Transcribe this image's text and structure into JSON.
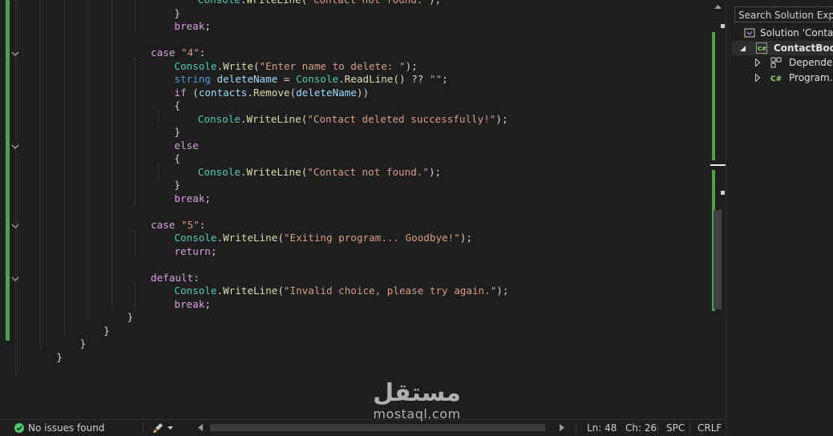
{
  "editor": {
    "lines": [
      [
        [
          "tk-class",
          "Console"
        ],
        [
          "tk-punct",
          "."
        ],
        [
          "tk-method",
          "WriteLine"
        ],
        [
          "tk-punct",
          "("
        ],
        [
          "tk-string",
          "\"Contact not found.\""
        ],
        [
          "tk-punct",
          ");"
        ]
      ],
      [
        [
          "tk-punct",
          "}"
        ]
      ],
      [
        [
          "tk-control",
          "break"
        ],
        [
          "tk-punct",
          ";"
        ]
      ],
      [],
      [
        [
          "tk-control",
          "case"
        ],
        [
          "tk-punct",
          " "
        ],
        [
          "tk-string",
          "\"4\""
        ],
        [
          "tk-punct",
          ":"
        ]
      ],
      [
        [
          "tk-class",
          "Console"
        ],
        [
          "tk-punct",
          "."
        ],
        [
          "tk-method",
          "Write"
        ],
        [
          "tk-punct",
          "("
        ],
        [
          "tk-string",
          "\"Enter name to delete: \""
        ],
        [
          "tk-punct",
          ");"
        ]
      ],
      [
        [
          "tk-keyword",
          "string"
        ],
        [
          "tk-punct",
          " "
        ],
        [
          "tk-var",
          "deleteName"
        ],
        [
          "tk-punct",
          " = "
        ],
        [
          "tk-class",
          "Console"
        ],
        [
          "tk-punct",
          "."
        ],
        [
          "tk-method",
          "ReadLine"
        ],
        [
          "tk-punct",
          "() ?? "
        ],
        [
          "tk-string",
          "\"\""
        ],
        [
          "tk-punct",
          ";"
        ]
      ],
      [
        [
          "tk-control",
          "if"
        ],
        [
          "tk-punct",
          " ("
        ],
        [
          "tk-var",
          "contacts"
        ],
        [
          "tk-punct",
          "."
        ],
        [
          "tk-method",
          "Remove"
        ],
        [
          "tk-punct",
          "("
        ],
        [
          "tk-var",
          "deleteName"
        ],
        [
          "tk-punct",
          "))"
        ]
      ],
      [
        [
          "tk-punct",
          "{"
        ]
      ],
      [
        [
          "tk-class",
          "Console"
        ],
        [
          "tk-punct",
          "."
        ],
        [
          "tk-method",
          "WriteLine"
        ],
        [
          "tk-punct",
          "("
        ],
        [
          "tk-string",
          "\"Contact deleted successfully!\""
        ],
        [
          "tk-punct",
          ");"
        ]
      ],
      [
        [
          "tk-punct",
          "}"
        ]
      ],
      [
        [
          "tk-control",
          "else"
        ]
      ],
      [
        [
          "tk-punct",
          "{"
        ]
      ],
      [
        [
          "tk-class",
          "Console"
        ],
        [
          "tk-punct",
          "."
        ],
        [
          "tk-method",
          "WriteLine"
        ],
        [
          "tk-punct",
          "("
        ],
        [
          "tk-string",
          "\"Contact not found.\""
        ],
        [
          "tk-punct",
          ");"
        ]
      ],
      [
        [
          "tk-punct",
          "}"
        ]
      ],
      [
        [
          "tk-control",
          "break"
        ],
        [
          "tk-punct",
          ";"
        ]
      ],
      [],
      [
        [
          "tk-control",
          "case"
        ],
        [
          "tk-punct",
          " "
        ],
        [
          "tk-string",
          "\"5\""
        ],
        [
          "tk-punct",
          ":"
        ]
      ],
      [
        [
          "tk-class",
          "Console"
        ],
        [
          "tk-punct",
          "."
        ],
        [
          "tk-method",
          "WriteLine"
        ],
        [
          "tk-punct",
          "("
        ],
        [
          "tk-string",
          "\"Exiting program... Goodbye!\""
        ],
        [
          "tk-punct",
          ");"
        ]
      ],
      [
        [
          "tk-control",
          "return"
        ],
        [
          "tk-punct",
          ";"
        ]
      ],
      [],
      [
        [
          "tk-control",
          "default"
        ],
        [
          "tk-punct",
          ":"
        ]
      ],
      [
        [
          "tk-class",
          "Console"
        ],
        [
          "tk-punct",
          "."
        ],
        [
          "tk-method",
          "WriteLine"
        ],
        [
          "tk-punct",
          "("
        ],
        [
          "tk-string",
          "\"Invalid choice, please try again.\""
        ],
        [
          "tk-punct",
          ");"
        ]
      ],
      [
        [
          "tk-control",
          "break"
        ],
        [
          "tk-punct",
          ";"
        ]
      ],
      [
        [
          "tk-punct",
          "}"
        ]
      ],
      [
        [
          "tk-punct",
          "}"
        ]
      ],
      [
        [
          "tk-punct",
          "}"
        ]
      ],
      [
        [
          "tk-punct",
          "}"
        ]
      ]
    ],
    "indents": [
      7,
      6,
      6,
      0,
      5,
      6,
      6,
      6,
      6,
      7,
      6,
      6,
      6,
      7,
      6,
      6,
      0,
      5,
      6,
      6,
      0,
      5,
      6,
      6,
      4,
      3,
      2,
      1
    ],
    "fold_lines": [
      4,
      11,
      17,
      21
    ],
    "colors": {
      "change_bar": "#4da34d",
      "keyword": "#569cd6",
      "control": "#d8a0df",
      "string": "#d69d85",
      "class": "#4ec9b0",
      "method": "#dcdcaa"
    }
  },
  "solution_explorer": {
    "search_placeholder": "Search Solution Explorer",
    "items": [
      {
        "label": "Solution 'ContactBook'",
        "icon": "solution-icon",
        "bold": false
      },
      {
        "label": "ContactBook",
        "icon": "csharp-project-icon",
        "bold": true
      },
      {
        "label": "Dependencies",
        "icon": "dependencies-icon",
        "bold": false
      },
      {
        "label": "Program.cs",
        "icon": "csharp-file-icon",
        "bold": false
      }
    ]
  },
  "status": {
    "issues": "No issues found",
    "line": "Ln: 48",
    "col": "Ch: 26",
    "spacing": "SPC",
    "line_ending": "CRLF"
  },
  "watermark": {
    "arabic": "مستقل",
    "latin": "mostaql.com"
  }
}
